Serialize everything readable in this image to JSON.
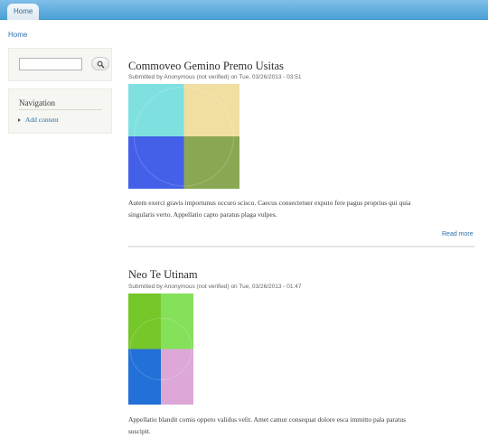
{
  "top_nav": {
    "home_tab": "Home"
  },
  "breadcrumb": {
    "home": "Home"
  },
  "search": {
    "value": "",
    "placeholder": ""
  },
  "navigation": {
    "title": "Navigation",
    "items": [
      {
        "label": "Add content"
      }
    ]
  },
  "nodes": [
    {
      "title": "Commoveo Gemino Premo Usitas",
      "submitted": "Submitted by Anonymous (not verified) on Tue, 03/26/2013 - 03:51",
      "image_colors": [
        "#7fe0e0",
        "#f1dfa1",
        "#4560e8",
        "#8aa853"
      ],
      "body_lines": [
        "Autem exerci gravis importunus occuro scisco. Caecus consectetuer exputo fere pagus proprius qui quia",
        "singularis verto. Appellatio capto paratus plaga vulpes."
      ],
      "read_more": "Read more"
    },
    {
      "title": "Neo Te Utinam",
      "submitted": "Submitted by Anonymous (not verified) on Tue, 03/26/2013 - 01:47",
      "image_colors": [
        "#76c72a",
        "#85e05a",
        "#2370d8",
        "#dda8d8"
      ],
      "body_lines": [
        "Appellatio blandit comis oppeto validus velit. Amet camur consequat dolore esca immitto pala paratus",
        "suscipit."
      ]
    }
  ]
}
